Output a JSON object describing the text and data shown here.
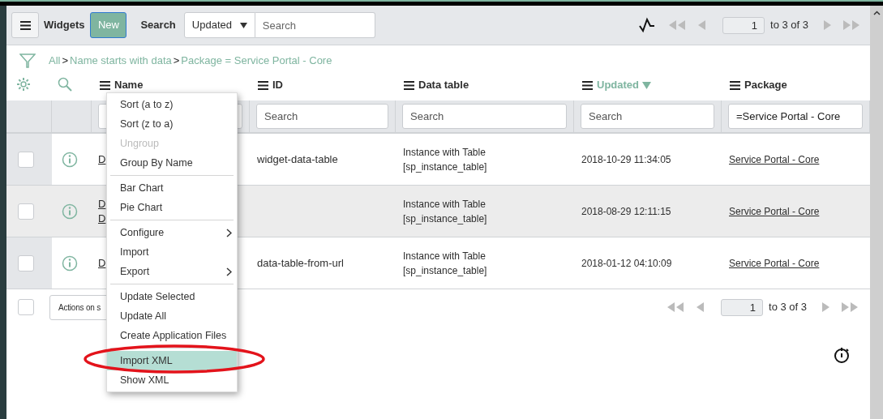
{
  "header": {
    "title": "Widgets",
    "new_button": "New",
    "search_label": "Search",
    "search_select": {
      "value": "Updated"
    },
    "search_input": {
      "placeholder": "Search"
    },
    "pager": {
      "page": "1",
      "range": "to 3 of 3"
    }
  },
  "breadcrumb": [
    {
      "kind": "link",
      "text": "All"
    },
    {
      "kind": "separator",
      "text": ">"
    },
    {
      "kind": "link",
      "text": "Name starts with data"
    },
    {
      "kind": "separator",
      "text": ">"
    },
    {
      "kind": "link",
      "text": "Package = Service Portal - Core"
    }
  ],
  "columns": [
    {
      "label": "Name",
      "sorted": false
    },
    {
      "label": "ID",
      "sorted": false,
      "filter": {
        "placeholder": "Search"
      }
    },
    {
      "label": "Data table",
      "sorted": false,
      "filter": {
        "placeholder": "Search"
      }
    },
    {
      "label": "Updated",
      "sorted": true,
      "filter": {
        "placeholder": "Search"
      }
    },
    {
      "label": "Package",
      "sorted": false,
      "filter": {
        "value": "=Service Portal - Core"
      }
    }
  ],
  "rows": [
    {
      "checked": false,
      "highlighted": false,
      "name": [
        "D"
      ],
      "id": "widget-data-table",
      "data_table": [
        "Instance with Table",
        "[sp_instance_table]"
      ],
      "updated": "2018-10-29 11:34:05",
      "package": "Service Portal - Core"
    },
    {
      "checked": false,
      "highlighted": true,
      "name": [
        "D",
        "D"
      ],
      "data_table": [
        "Instance with Table",
        "[sp_instance_table]"
      ],
      "updated": "2018-08-29 12:11:15",
      "package": "Service Portal - Core"
    },
    {
      "checked": false,
      "highlighted": false,
      "name": [
        "D"
      ],
      "id": "data-table-from-url",
      "data_table": [
        "Instance with Table",
        "[sp_instance_table]"
      ],
      "updated": "2018-01-12 04:10:09",
      "package": "Service Portal - Core"
    }
  ],
  "footer": {
    "select_all_checked": false,
    "actions_button": "Actions on s",
    "pager": {
      "page": "1",
      "range": "to 3 of 3"
    }
  },
  "context_menu": {
    "groups": [
      [
        {
          "label": "Sort (a to z)",
          "disabled": false,
          "selected": false,
          "submenu": false
        },
        {
          "label": "Sort (z to a)",
          "disabled": false,
          "selected": false,
          "submenu": false
        },
        {
          "label": "Ungroup",
          "disabled": true,
          "selected": false,
          "submenu": false
        },
        {
          "label": "Group By Name",
          "disabled": false,
          "selected": false,
          "submenu": false
        }
      ],
      [
        {
          "label": "Bar Chart",
          "disabled": false,
          "selected": false,
          "submenu": false
        },
        {
          "label": "Pie Chart",
          "disabled": false,
          "selected": false,
          "submenu": false
        }
      ],
      [
        {
          "label": "Configure",
          "disabled": false,
          "selected": false,
          "submenu": true
        },
        {
          "label": "Import",
          "disabled": false,
          "selected": false,
          "submenu": false
        },
        {
          "label": "Export",
          "disabled": false,
          "selected": false,
          "submenu": true
        }
      ],
      [
        {
          "label": "Update Selected",
          "disabled": false,
          "selected": false,
          "submenu": false
        },
        {
          "label": "Update All",
          "disabled": false,
          "selected": false,
          "submenu": false
        },
        {
          "label": "Create Application Files",
          "disabled": false,
          "selected": false,
          "submenu": false
        }
      ],
      [
        {
          "label": "Import XML",
          "disabled": false,
          "selected": true,
          "submenu": false
        },
        {
          "label": "Show XML",
          "disabled": false,
          "selected": false,
          "submenu": false
        }
      ]
    ]
  }
}
